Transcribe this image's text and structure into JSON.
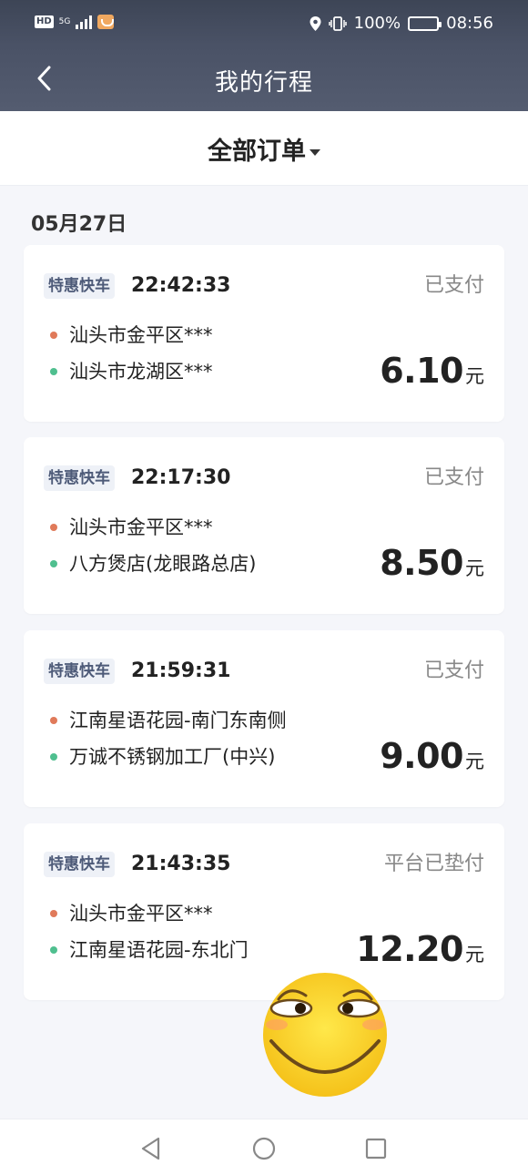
{
  "status_bar": {
    "hd": "HD",
    "network": "5G",
    "battery_pct": "100%",
    "time": "08:56"
  },
  "header": {
    "title": "我的行程"
  },
  "filter": {
    "label": "全部订单"
  },
  "date_group": {
    "label": "05月27日"
  },
  "orders": [
    {
      "tag": "特惠快车",
      "time": "22:42:33",
      "status": "已支付",
      "from": "汕头市金平区***",
      "to": "汕头市龙湖区***",
      "price": "6.10",
      "unit": "元"
    },
    {
      "tag": "特惠快车",
      "time": "22:17:30",
      "status": "已支付",
      "from": "汕头市金平区***",
      "to": "八方煲店(龙眼路总店)",
      "price": "8.50",
      "unit": "元"
    },
    {
      "tag": "特惠快车",
      "time": "21:59:31",
      "status": "已支付",
      "from": "江南星语花园-南门东南侧",
      "to": "万诚不锈钢加工厂(中兴)",
      "price": "9.00",
      "unit": "元"
    },
    {
      "tag": "特惠快车",
      "time": "21:43:35",
      "status": "平台已垫付",
      "from": "汕头市金平区***",
      "to": "江南星语花园-东北门",
      "price": "12.20",
      "unit": "元"
    }
  ],
  "colors": {
    "header_bg": "#4a5266",
    "from_dot": "#e07a5a",
    "to_dot": "#4fbf8f",
    "tag_bg": "#eef1f7",
    "tag_text": "#4d5a78"
  },
  "icons": {
    "back": "chevron-left-icon",
    "location": "location-pin-icon",
    "vibrate": "vibrate-icon",
    "battery": "battery-icon",
    "nav_back": "triangle-back-icon",
    "nav_home": "circle-home-icon",
    "nav_recent": "square-recent-icon",
    "sticker": "smirking-face-emoji"
  }
}
